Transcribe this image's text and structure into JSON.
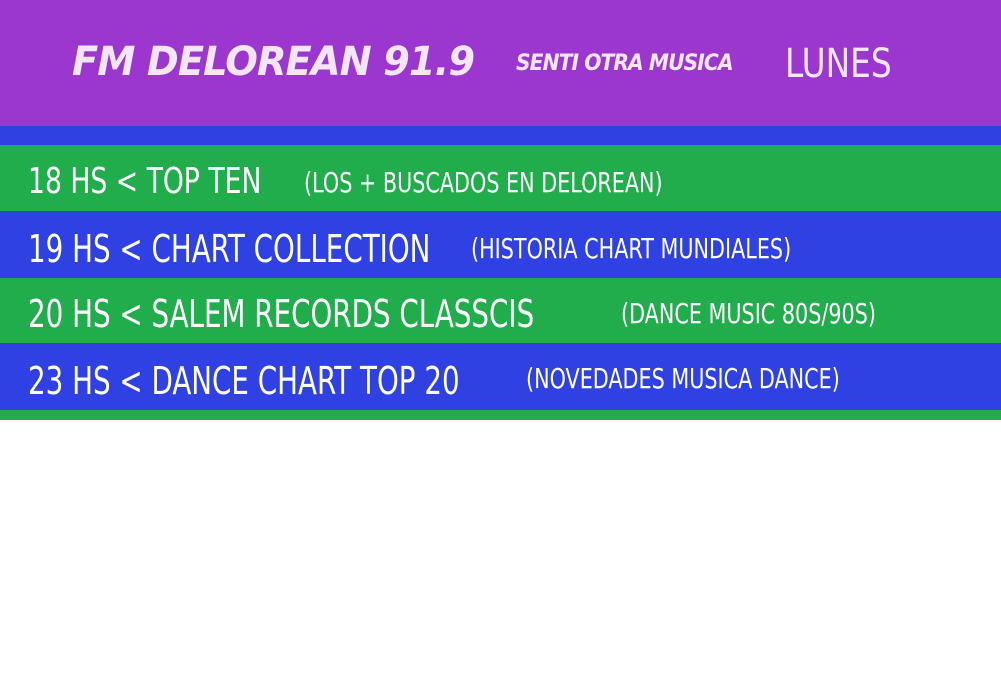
{
  "header": {
    "brand": "FM DELOREAN 91.9",
    "slogan": "SENTI OTRA MUSICA",
    "day": "LUNES"
  },
  "schedule": [
    {
      "slot": "18 HS < TOP TEN",
      "note": "(LOS + BUSCADOS EN DELOREAN)",
      "color": "#21ad4c"
    },
    {
      "slot": "19 HS < CHART COLLECTION",
      "note": "(HISTORIA CHART MUNDIALES)",
      "color": "#2f41e2"
    },
    {
      "slot": "20 HS < SALEM RECORDS CLASSCIS",
      "note": "(DANCE MUSIC 80S/90S)",
      "color": "#21ad4c"
    },
    {
      "slot": "23 HS < DANCE CHART TOP 20",
      "note": "(NOVEDADES MUSICA DANCE)",
      "color": "#2f41e2"
    }
  ],
  "colors": {
    "header_bg": "#9b36cf",
    "green": "#21ad4c",
    "blue": "#2f41e2",
    "text_light": "#f3e6f7"
  }
}
